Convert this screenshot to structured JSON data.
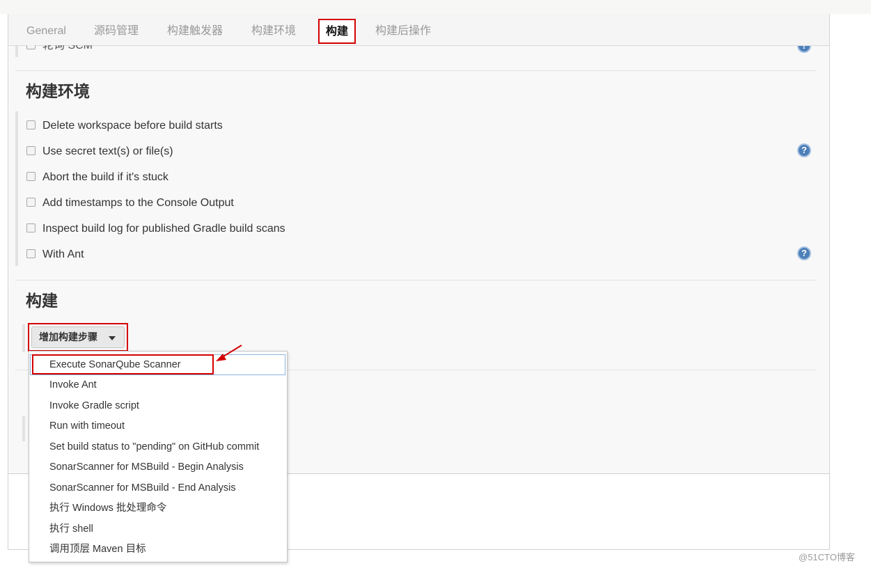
{
  "tabs": [
    {
      "label": "General"
    },
    {
      "label": "源码管理"
    },
    {
      "label": "构建触发器"
    },
    {
      "label": "构建环境"
    },
    {
      "label": "构建"
    },
    {
      "label": "构建后操作"
    }
  ],
  "active_tab": "构建",
  "scm_poll_label": "轮询 SCM",
  "build_env": {
    "title": "构建环境",
    "options": [
      {
        "label": "Delete workspace before build starts",
        "checked": false
      },
      {
        "label": "Use secret text(s) or file(s)",
        "checked": false
      },
      {
        "label": "Abort the build if it's stuck",
        "checked": false
      },
      {
        "label": "Add timestamps to the Console Output",
        "checked": false
      },
      {
        "label": "Inspect build log for published Gradle build scans",
        "checked": false
      },
      {
        "label": "With Ant",
        "checked": false
      }
    ]
  },
  "build": {
    "title": "构建",
    "add_step_label": "增加构建步骤"
  },
  "dropdown": {
    "items": [
      "Execute SonarQube Scanner",
      "Invoke Ant",
      "Invoke Gradle script",
      "Run with timeout",
      "Set build status to \"pending\" on GitHub commit",
      "SonarScanner for MSBuild - Begin Analysis",
      "SonarScanner for MSBuild - End Analysis",
      "执行 Windows 批处理命令",
      "执行 shell",
      "调用顶层 Maven 目标"
    ]
  },
  "help_icon_glyph": "?",
  "watermark": "@51CTO博客",
  "colors": {
    "highlight_red": "#d40000",
    "help_blue": "#4d7fb8"
  }
}
